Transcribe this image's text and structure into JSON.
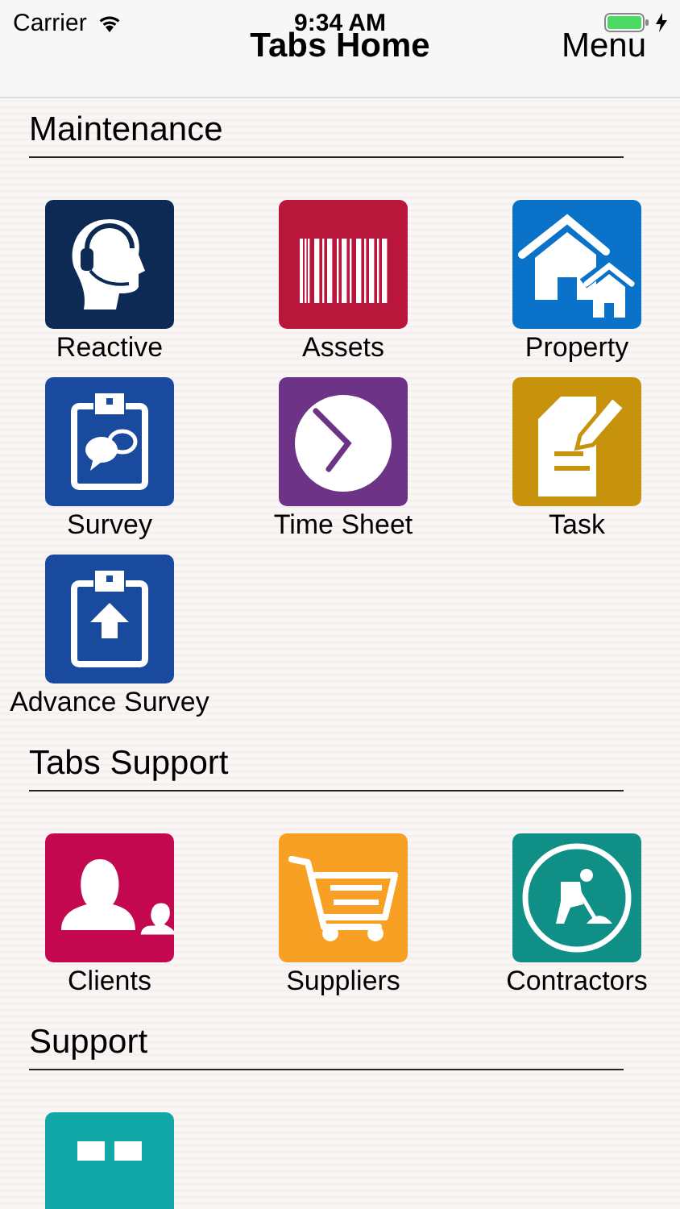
{
  "status_bar": {
    "carrier": "Carrier",
    "time": "9:34 AM"
  },
  "nav_bar": {
    "title": "Tabs Home",
    "menu": "Menu"
  },
  "sections": [
    {
      "title": "Maintenance",
      "tiles": [
        {
          "label": "Reactive",
          "kind": "headset",
          "color": "#0d2a55"
        },
        {
          "label": "Assets",
          "kind": "barcode",
          "color": "#b8163a"
        },
        {
          "label": "Property",
          "kind": "houses",
          "color": "#0a72c8"
        },
        {
          "label": "Survey",
          "kind": "clipboard-chat",
          "color": "#1a4a9e"
        },
        {
          "label": "Time Sheet",
          "kind": "clock",
          "color": "#6c3386"
        },
        {
          "label": "Task",
          "kind": "document-pencil",
          "color": "#c8930c"
        },
        {
          "label": "Advance Survey",
          "kind": "clipboard-upload",
          "color": "#1a4a9e"
        }
      ]
    },
    {
      "title": "Tabs Support",
      "tiles": [
        {
          "label": "Clients",
          "kind": "people",
          "color": "#c4084f"
        },
        {
          "label": "Suppliers",
          "kind": "cart",
          "color": "#f7a024"
        },
        {
          "label": "Contractors",
          "kind": "worker",
          "color": "#108f86"
        }
      ]
    },
    {
      "title": "Support",
      "tiles": [
        {
          "kind": "grid",
          "color": "#13a8a8"
        }
      ]
    }
  ]
}
